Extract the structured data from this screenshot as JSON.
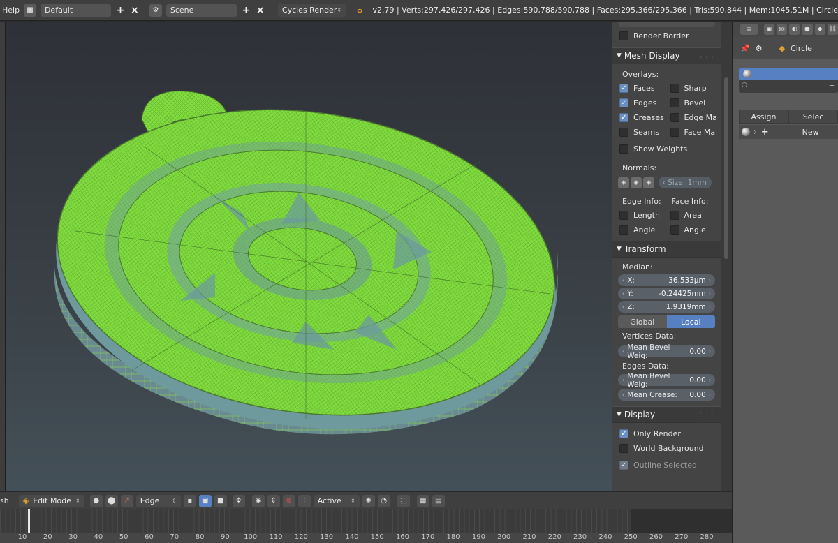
{
  "topbar": {
    "help": "Help",
    "layout_name": "Default",
    "scene_name": "Scene",
    "render_engine": "Cycles Render",
    "stats": "v2.79 | Verts:297,426/297,426 | Edges:590,788/590,788 | Faces:295,366/295,366 | Tris:590,844 | Mem:1045.51M | Circle"
  },
  "npanel": {
    "render_border": "Render Border",
    "mesh_display": {
      "title": "Mesh Display",
      "overlays_label": "Overlays:",
      "faces": "Faces",
      "sharp": "Sharp",
      "edges": "Edges",
      "bevel": "Bevel",
      "creases": "Creases",
      "edge_marks": "Edge Ma",
      "seams": "Seams",
      "face_marks": "Face Ma",
      "show_weights": "Show Weights",
      "normals_label": "Normals:",
      "normals_size": "Size:  1mm",
      "edge_info": "Edge Info:",
      "face_info": "Face Info:",
      "length": "Length",
      "area": "Area",
      "angle": "Angle",
      "face_angle": "Angle"
    },
    "transform": {
      "title": "Transform",
      "median": "Median:",
      "x_label": "X:",
      "x": "36.533µm",
      "y_label": "Y:",
      "y": "-0.24425mm",
      "z_label": "Z:",
      "z": "1.9319mm",
      "global": "Global",
      "local": "Local",
      "vertices_data": "Vertices Data:",
      "mean_bevel_v_label": "Mean Bevel Weig:",
      "mean_bevel_v": "0.00",
      "edges_data": "Edges Data:",
      "mean_bevel_e_label": "Mean Bevel Weig:",
      "mean_bevel_e": "0.00",
      "mean_crease_label": "Mean Crease:",
      "mean_crease": "0.00"
    },
    "display": {
      "title": "Display",
      "only_render": "Only Render",
      "world_background": "World Background",
      "outline_selected": "Outline Selected"
    }
  },
  "props": {
    "context": "Circle",
    "assign": "Assign",
    "select": "Selec",
    "new": "New"
  },
  "bottombar": {
    "mode_prefix": "sh",
    "mode": "Edit Mode",
    "select_mode": "Edge",
    "pivot": "Active"
  },
  "timeline": {
    "ticks": [
      "10",
      "20",
      "30",
      "40",
      "50",
      "60",
      "70",
      "80",
      "90",
      "100",
      "110",
      "120",
      "130",
      "140",
      "150",
      "160",
      "170",
      "180",
      "190",
      "200",
      "210",
      "220",
      "230",
      "240",
      "250",
      "260",
      "270",
      "280"
    ]
  },
  "colors": {
    "accent": "#5680c2",
    "mesh": "#7ddb3a",
    "mesh_dark": "#5a9a2a"
  }
}
